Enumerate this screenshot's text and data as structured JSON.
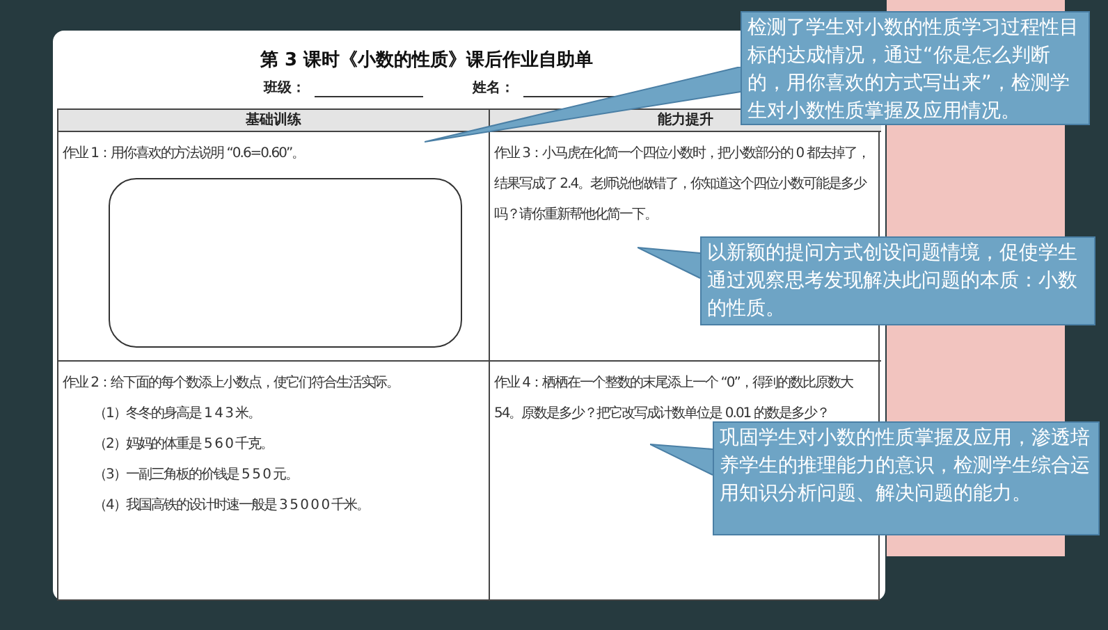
{
  "document": {
    "title": "第 3 课时《小数的性质》课后作业自助单",
    "fields": [
      {
        "label": "班级："
      },
      {
        "label": "姓名："
      }
    ],
    "columns": [
      "基础训练",
      "能力提升"
    ],
    "rows": [
      {
        "left": {
          "lines": [
            "作业 1：用你喜欢的方法说明 “0.6=0.60”。"
          ],
          "answer_box": true
        },
        "right": {
          "lines": [
            "作业 3：小马虎在化简一个四位小数时，把小数部分的 0 都去掉了，结果写成了 2.4。老师说他做错了，你知道这个四位小数可能是多少吗？请你重新帮他化简一下。"
          ],
          "answer_box": false
        }
      },
      {
        "left": {
          "lines": [
            "作业 2：给下面的每个数添上小数点，使它们符合生活实际。",
            "（1）冬冬的身高是 1 4 3 米。",
            "（2）妈妈的体重是 5 6 0 千克。",
            "（3）一副三角板的价钱是 5 5 0 元。",
            "（4）我国高铁的设计时速一般是 3 5 0 0 0 千米。"
          ],
          "answer_box": false
        },
        "right": {
          "lines": [
            "作业 4：栖栖在一个整数的末尾添上一个 “0”，得到的数比原数大 54。原数是多少？把它改写成计数单位是 0.01 的数是多少？"
          ],
          "answer_box": false
        }
      }
    ]
  },
  "callouts": [
    {
      "text": "检测了学生对小数的性质学习过程性目标的达成情况，通过“你是怎么判断的，用你喜欢的方式写出来”，检测学生对小数性质掌握及应用情况。"
    },
    {
      "text": "以新颖的提问方式创设问题情境，促使学生通过观察思考发现解决此问题的本质：小数的性质。"
    },
    {
      "text": "巩固学生对小数的性质掌握及应用，渗透培养学生的推理能力的意识，检测学生综合运用知识分析问题、解决问题的能力。"
    }
  ]
}
